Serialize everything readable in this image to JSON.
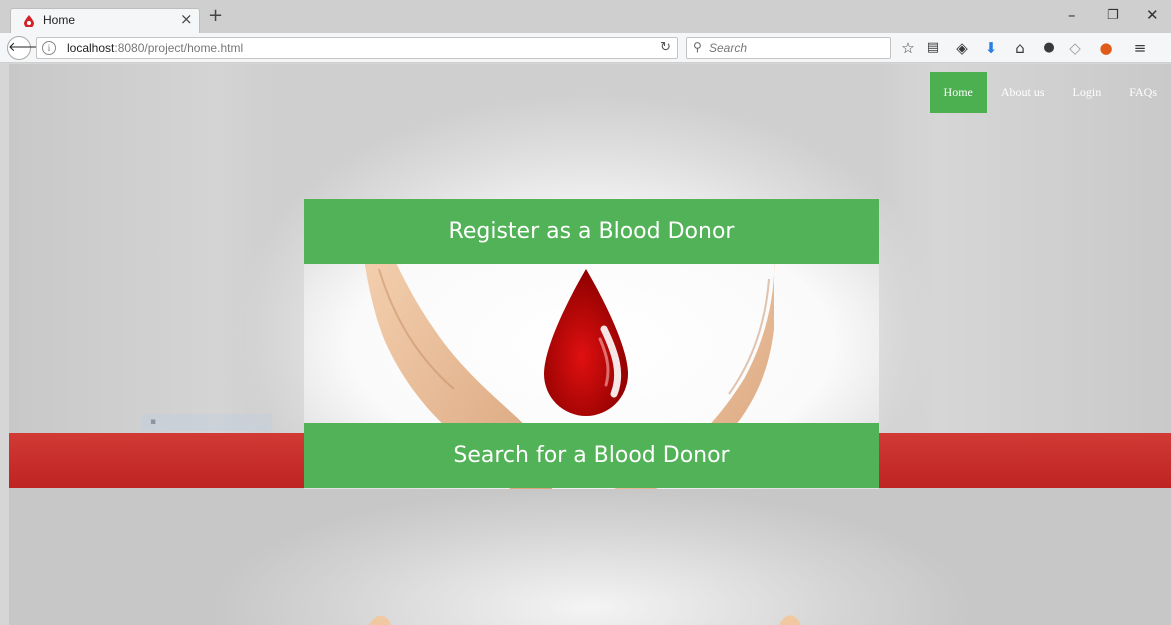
{
  "browser": {
    "tab_title": "Home",
    "url_host": "localhost",
    "url_path": ":8080/project/home.html",
    "search_placeholder": "Search"
  },
  "nav": {
    "items": [
      {
        "label": "Home",
        "active": true
      },
      {
        "label": "About us",
        "active": false
      },
      {
        "label": "Login",
        "active": false
      },
      {
        "label": "FAQs",
        "active": false
      }
    ]
  },
  "main": {
    "register_label": "Register as a Blood Donor",
    "search_label": "Search for a Blood Donor"
  },
  "colors": {
    "accent_green": "#52b257",
    "band_red": "#c62d2b",
    "drop_red": "#d40000"
  }
}
